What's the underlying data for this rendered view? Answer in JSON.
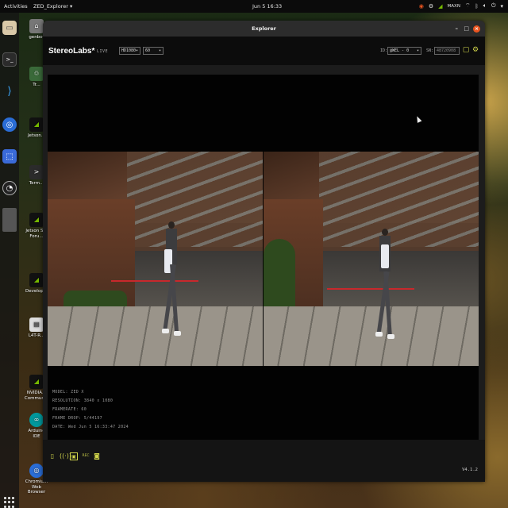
{
  "topbar": {
    "activities": "Activities",
    "app_menu": "ZED_Explorer ▾",
    "clock": "Jun 5  16:33",
    "tray_label": "MAXN"
  },
  "desktop": {
    "icons": [
      {
        "label": "genbot",
        "icon": "home-folder-icon"
      },
      {
        "label": "Tr...",
        "icon": "trash-icon"
      },
      {
        "label": "Jetson...",
        "icon": "nvidia-icon"
      },
      {
        "label": "Term...",
        "icon": "terminal-icon"
      },
      {
        "label": "Jetson S... Foru...",
        "icon": "nvidia-icon"
      },
      {
        "label": "Develop...",
        "icon": "nvidia-icon"
      },
      {
        "label": "L4T-R...",
        "icon": "document-icon"
      },
      {
        "label": "NVIDIA... Commun...",
        "icon": "nvidia-icon"
      },
      {
        "label": "Arduino IDE",
        "icon": "arduino-icon"
      },
      {
        "label": "Chromium Web Browser",
        "icon": "chromium-icon"
      }
    ]
  },
  "window": {
    "title": "Explorer",
    "minimize": "–",
    "maximize": "□",
    "close": "×"
  },
  "header": {
    "logo": "StereoLabs*",
    "status": "LIVE",
    "resolution_select": "HD1080",
    "fps_select": "60",
    "id_label": "ID:",
    "id_select": "@WEL - 0",
    "sn_label": "SN:",
    "sn_value": "48720908"
  },
  "camera_info": {
    "model": "MODEL: ZED X",
    "resolution": "RESOLUTION: 3840 x 1080",
    "framerate": "FRAMERATE: 60",
    "frame_drop": "FRAME DROP: 5/44197",
    "date": "DATE: Wed Jun 5 16:33:47 2024"
  },
  "footer": {
    "version": "V4.1.2",
    "rec_label": "REC"
  },
  "colors": {
    "accent": "#cfd34a",
    "close": "#e95420",
    "nvidia": "#76b900"
  }
}
